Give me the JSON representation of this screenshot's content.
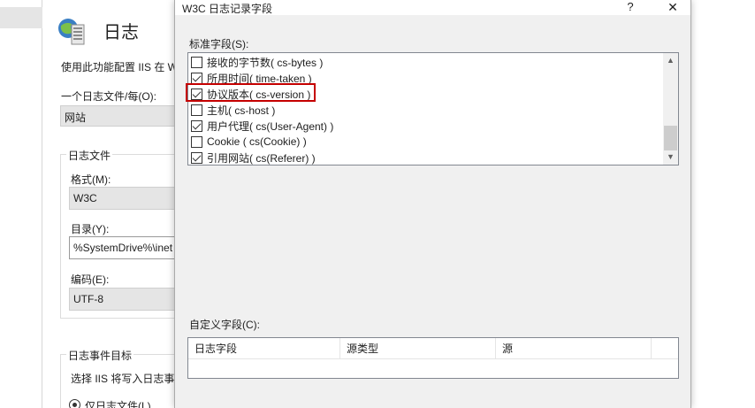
{
  "background": {
    "page_title": "日志",
    "description": "使用此功能配置 IIS 在 W",
    "log_per_label": "一个日志文件/每(O):",
    "log_per_value": "网站",
    "log_file_group": "日志文件",
    "format_label": "格式(M):",
    "format_value": "W3C",
    "directory_label": "目录(Y):",
    "directory_value": "%SystemDrive%\\inet",
    "encoding_label": "编码(E):",
    "encoding_value": "UTF-8",
    "event_group": "日志事件目标",
    "event_desc": "选择 IIS 将写入日志事",
    "radio_only_label": "仅日志文件(L)"
  },
  "dialog": {
    "title": "W3C 日志记录字段",
    "help": "?",
    "close": "✕",
    "standard_fields_label": "标准字段(S):",
    "standard_fields": [
      {
        "label": "接收的字节数( cs-bytes )",
        "checked": false
      },
      {
        "label": "所用时间( time-taken )",
        "checked": true
      },
      {
        "label": "协议版本( cs-version )",
        "checked": true,
        "highlighted": true
      },
      {
        "label": "主机( cs-host )",
        "checked": false
      },
      {
        "label": "用户代理( cs(User-Agent) )",
        "checked": true
      },
      {
        "label": "Cookie ( cs(Cookie) )",
        "checked": false
      },
      {
        "label": "引用网站( cs(Referer) )",
        "checked": true
      }
    ],
    "custom_fields_label": "自定义字段(C):",
    "custom_columns": [
      "日志字段",
      "源类型",
      "源"
    ],
    "highlight_color": "#c50000"
  }
}
